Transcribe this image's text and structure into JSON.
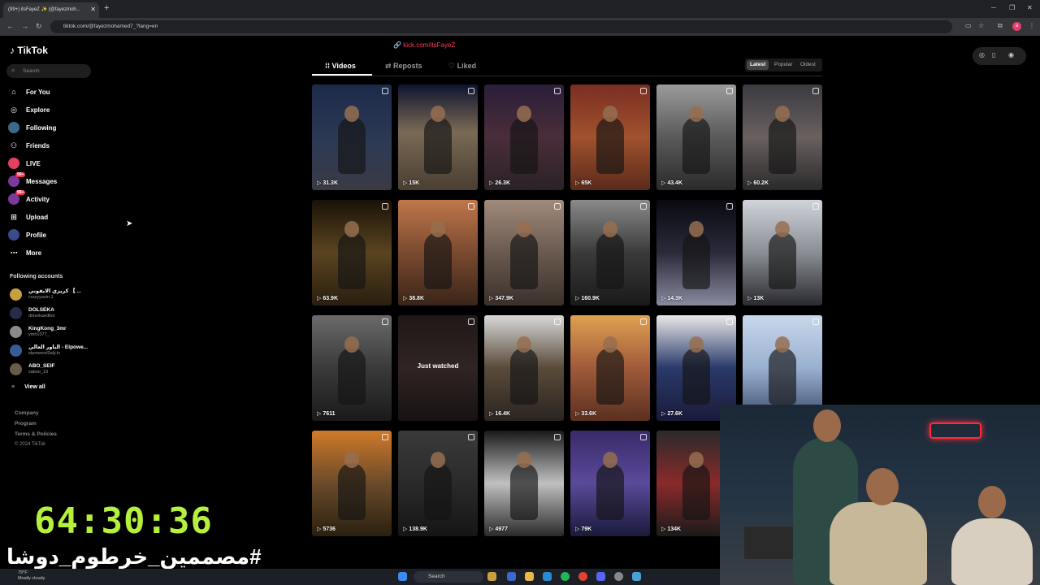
{
  "browser": {
    "tab_title": "(99+) itsFayeZ ✨ (@fayezmoh...",
    "url": "tiktok.com/@fayezmohamed7_?lang=en"
  },
  "sidebar": {
    "logo": "TikTok",
    "search_placeholder": "Search",
    "nav": [
      {
        "label": "For You",
        "icon": "home-icon"
      },
      {
        "label": "Explore",
        "icon": "compass-icon"
      },
      {
        "label": "Following",
        "icon": "following-icon"
      },
      {
        "label": "Friends",
        "icon": "friends-icon"
      },
      {
        "label": "LIVE",
        "icon": "live-icon"
      },
      {
        "label": "Messages",
        "icon": "messages-icon",
        "badge": "99+"
      },
      {
        "label": "Activity",
        "icon": "activity-icon",
        "badge": "99+"
      },
      {
        "label": "Upload",
        "icon": "upload-icon"
      },
      {
        "label": "Profile",
        "icon": "profile-icon"
      },
      {
        "label": "More",
        "icon": "more-icon"
      }
    ],
    "following_title": "Following accounts",
    "accounts": [
      {
        "name": "كريزي الايفوني 【 ...",
        "handle": "crazyyasin.1"
      },
      {
        "name": "DOLSEKA",
        "handle": "dolsekaeditor"
      },
      {
        "name": "KingKong_3mr",
        "handle": "ymh1077_"
      },
      {
        "name": "الباور العالي - Elpowe...",
        "handle": "elpowerel3aly.tv"
      },
      {
        "name": "ABO_SEIF",
        "handle": "saboo_19"
      }
    ],
    "view_all": "View all",
    "footer": [
      "Company",
      "Program",
      "Terms & Policies"
    ],
    "copyright": "© 2024 TikTok"
  },
  "profile": {
    "link": "kick.com/itsFayeZ",
    "tabs": [
      "Videos",
      "Reposts",
      "Liked"
    ],
    "sort": [
      "Latest",
      "Popular",
      "Oldest"
    ]
  },
  "videos": [
    {
      "views": "31.3K",
      "bg": "linear-gradient(180deg,#1c2a4a 0%,#2d3a55 55%,#3a3a44 100%)"
    },
    {
      "views": "15K",
      "bg": "linear-gradient(180deg,#0e1430 0%,#7a6a55 45%,#4a3e32 100%)"
    },
    {
      "views": "26.3K",
      "bg": "linear-gradient(180deg,#2a1e3a 0%,#4a2d3a 50%,#2a2226 100%)"
    },
    {
      "views": "65K",
      "bg": "linear-gradient(180deg,#7a2e22 0%,#a0522d 50%,#5a2a1a 100%)"
    },
    {
      "views": "43.4K",
      "bg": "linear-gradient(180deg,#9a9a9a 0%,#5a5a5a 50%,#2a2a2a 100%)"
    },
    {
      "views": "60.2K",
      "bg": "linear-gradient(180deg,#3a3a40 0%,#6a6060 50%,#2a2a2a 100%)"
    },
    {
      "views": "63.9K",
      "bg": "linear-gradient(180deg,#1a1208 0%,#5a4420 50%,#2a1e10 100%)"
    },
    {
      "views": "38.8K",
      "bg": "linear-gradient(180deg,#c0774a 0%,#7a4a30 50%,#3a2418 100%)"
    },
    {
      "views": "347.9K",
      "bg": "linear-gradient(180deg,#a08a7a 0%,#6a5a50 50%,#3a302a 100%)"
    },
    {
      "views": "160.9K",
      "bg": "linear-gradient(180deg,#8a8a8a 0%,#3a3a3a 50%,#1a1a1a 100%)"
    },
    {
      "views": "14.3K",
      "bg": "linear-gradient(180deg,#0a0a12 0%,#2a2a3a 50%,#8a8aa0 100%)"
    },
    {
      "views": "13K",
      "bg": "linear-gradient(180deg,#d0d4da 0%,#8a8e94 50%,#2a2a30 100%)"
    },
    {
      "views": "7611",
      "bg": "linear-gradient(180deg,#6a6a6a 0%,#3a3a3a 50%,#1a1a1a 100%)"
    },
    {
      "views": "",
      "bg": "linear-gradient(180deg,#201818 0%,#302424 50%,#181212 100%)",
      "overlay": "Just watched"
    },
    {
      "views": "16.4K",
      "bg": "linear-gradient(180deg,#d8d8d8 0%,#5a4a3a 50%,#2a2420 100%)"
    },
    {
      "views": "33.6K",
      "bg": "linear-gradient(180deg,#e0a050 0%,#a05a3a 50%,#5a3020 100%)"
    },
    {
      "views": "27.6K",
      "bg": "linear-gradient(180deg,#e8e8e8 0%,#2a3a6a 50%,#1a1a3a 100%)"
    },
    {
      "views": "",
      "bg": "linear-gradient(180deg,#c8d8ec 0%,#9ab0d0 50%,#3a4a6a 100%)"
    },
    {
      "views": "5736",
      "bg": "linear-gradient(180deg,#d07a2a 0%,#6a4a2a 50%,#2a2010 100%)"
    },
    {
      "views": "138.9K",
      "bg": "linear-gradient(180deg,#3a3a3a 0%,#2a2a2a 50%,#151515 100%)"
    },
    {
      "views": "4977",
      "bg": "linear-gradient(180deg,#1a1a1a 0%,#c0c0c0 50%,#2a2a2a 100%)"
    },
    {
      "views": "79K",
      "bg": "linear-gradient(180deg,#3a2a6a 0%,#5a4a9a 50%,#1a1a3a 100%)"
    },
    {
      "views": "134K",
      "bg": "linear-gradient(180deg,#2a2a2a 0%,#8a2a2a 50%,#1a1a1a 100%)"
    }
  ],
  "overlay": {
    "timer": "64:30:36",
    "hashtag": "#مصممين_خرطوم_دوشا"
  },
  "taskbar": {
    "weather_temp": "79°F",
    "weather_desc": "Mostly cloudy",
    "search": "Search"
  }
}
